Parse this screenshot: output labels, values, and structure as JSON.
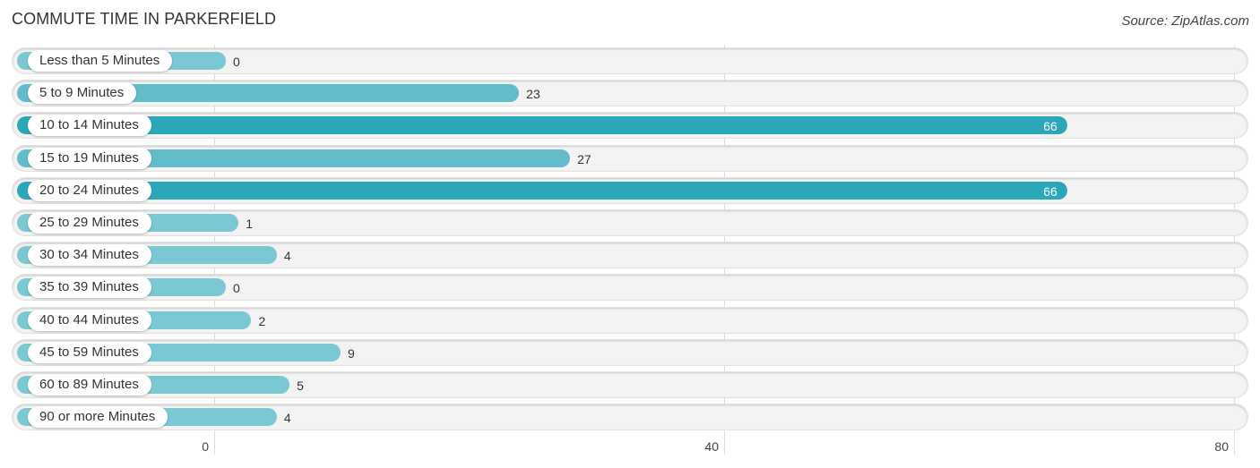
{
  "header": {
    "title": "COMMUTE TIME IN PARKERFIELD",
    "source": "Source: ZipAtlas.com"
  },
  "colors": {
    "bar_highlight": "#2aa8ba",
    "bar_normal": "#79c8d3",
    "bar_medium": "#62bccb",
    "track": "#f3f3f3"
  },
  "chart_data": {
    "type": "bar",
    "orientation": "horizontal",
    "title": "COMMUTE TIME IN PARKERFIELD",
    "xlabel": "",
    "ylabel": "",
    "xlim": [
      0,
      80
    ],
    "x_ticks": [
      "0",
      "40",
      "80"
    ],
    "x_tick_values": [
      0,
      40,
      80
    ],
    "grid": true,
    "categories": [
      "Less than 5 Minutes",
      "5 to 9 Minutes",
      "10 to 14 Minutes",
      "15 to 19 Minutes",
      "20 to 24 Minutes",
      "25 to 29 Minutes",
      "30 to 34 Minutes",
      "35 to 39 Minutes",
      "40 to 44 Minutes",
      "45 to 59 Minutes",
      "60 to 89 Minutes",
      "90 or more Minutes"
    ],
    "values": [
      0,
      23,
      66,
      27,
      66,
      1,
      4,
      0,
      2,
      9,
      5,
      4
    ],
    "value_labels": [
      "0",
      "23",
      "66",
      "27",
      "66",
      "1",
      "4",
      "0",
      "2",
      "9",
      "5",
      "4"
    ]
  }
}
